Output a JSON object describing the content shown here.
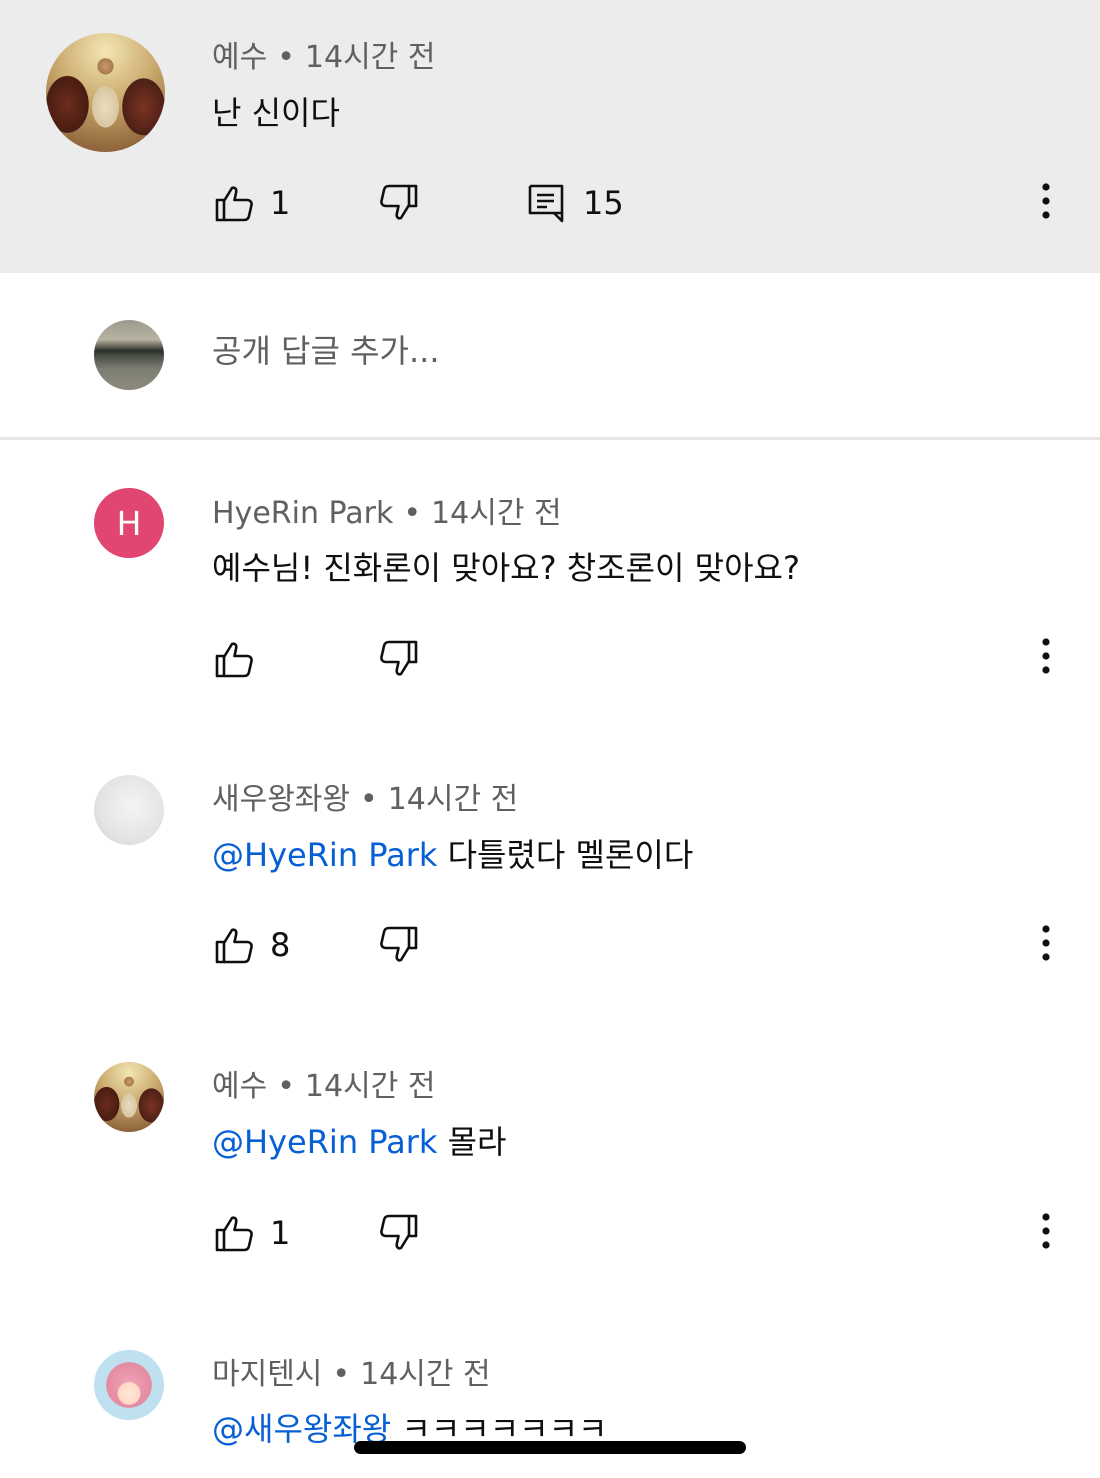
{
  "top_comment": {
    "author": "예수",
    "time": "14시간 전",
    "text": "난 신이다",
    "likes": "1",
    "replies": "15"
  },
  "reply_box": {
    "placeholder": "공개 답글 추가..."
  },
  "replies": [
    {
      "author": "HyeRin Park",
      "avatar_letter": "H",
      "time": "14시간 전",
      "mention": "",
      "text": "예수님! 진화론이 맞아요? 창조론이 맞아요?",
      "likes": ""
    },
    {
      "author": "새우왕좌왕",
      "time": "14시간 전",
      "mention": "@HyeRin Park",
      "text": "다틀렸다 멜론이다",
      "likes": "8"
    },
    {
      "author": "예수",
      "time": "14시간 전",
      "mention": "@HyeRin Park",
      "text": "몰라",
      "likes": "1"
    },
    {
      "author": "마지텐시",
      "time": "14시간 전",
      "mention": "@새우왕좌왕",
      "text": "ㅋㅋㅋㅋㅋㅋㅋ",
      "likes": ""
    }
  ],
  "colors": {
    "highlight_bg": "#ececec",
    "mention": "#065fd4",
    "avatar_h": "#e0466f",
    "meta_text": "#606060"
  },
  "icons": {
    "like": "thumbs-up-icon",
    "dislike": "thumbs-down-icon",
    "reply": "comment-icon",
    "more": "more-vert-icon"
  }
}
